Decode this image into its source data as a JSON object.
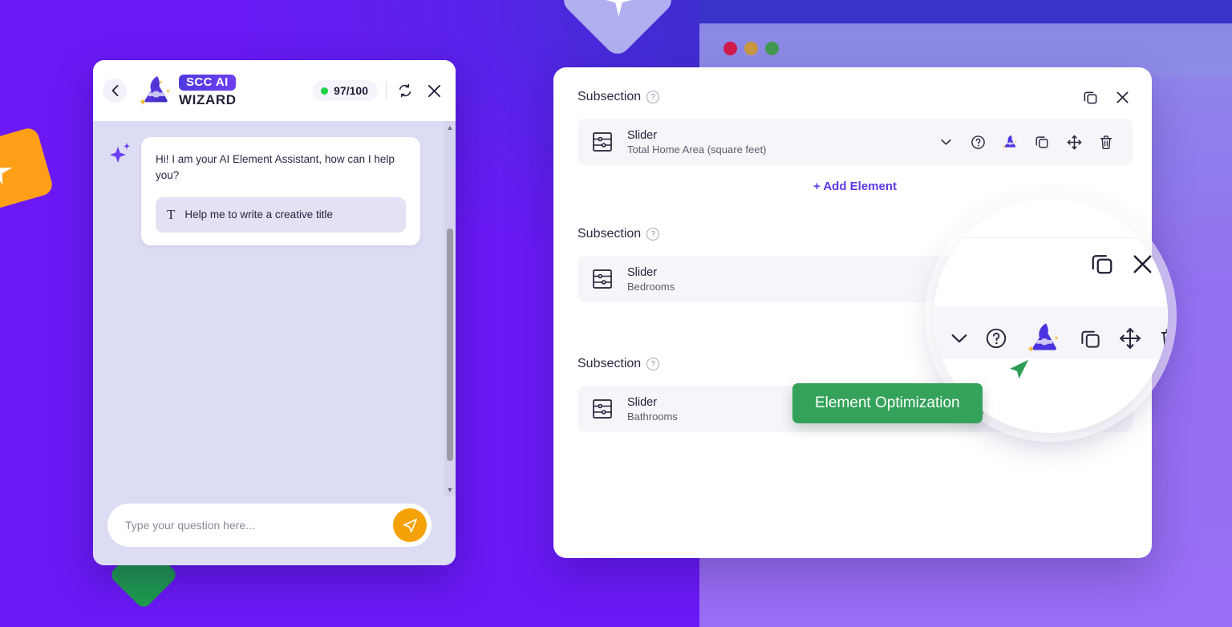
{
  "background": {
    "gradient_from": "#3a32c9",
    "gradient_to": "#6a19f5",
    "right_panel_from": "#8f8ce9",
    "right_panel_to": "#9a6df4",
    "shapes": [
      {
        "name": "orange-square",
        "color": "#ff9f17"
      },
      {
        "name": "lilac-diamond",
        "color": "#b0b0f0"
      },
      {
        "name": "green-diamond",
        "color": "#1f9d4f"
      }
    ]
  },
  "window_controls": {
    "close_color": "#cf1a4a",
    "minimize_color": "#c89640",
    "maximize_color": "#41974f"
  },
  "chat": {
    "back_icon": "chevron-left-icon",
    "brand": {
      "pill": "SCC AI",
      "word": "WIZARD",
      "logo": "wizard-hat-icon"
    },
    "credits": {
      "value": "97/100",
      "status_color": "#1fd14b"
    },
    "refresh_icon": "refresh-icon",
    "close_icon": "close-icon",
    "message": {
      "avatar_icon": "sparkle-icon",
      "text": "Hi! I am your AI Element Assistant, how can I help you?",
      "suggestion": {
        "icon": "text-format-icon",
        "label": "Help me to write a creative title"
      }
    },
    "input": {
      "placeholder": "Type your question here...",
      "value": "",
      "send_icon": "send-icon",
      "send_color": "#f5a208"
    },
    "scrollbar": {
      "up_icon": "caret-up-icon",
      "down_icon": "caret-down-icon"
    }
  },
  "builder": {
    "help_glyph": "?",
    "add_element_label": "+ Add Element",
    "subsections": [
      {
        "title": "Subsection",
        "actions": [
          "duplicate-icon",
          "close-icon"
        ],
        "element": {
          "icon": "slider-element-icon",
          "type": "Slider",
          "name": "Total Home Area (square feet)",
          "actions": [
            "chevron-down-icon",
            "help-icon",
            "wizard-icon",
            "duplicate-icon",
            "move-icon",
            "delete-icon"
          ]
        },
        "show_add_element": true
      },
      {
        "title": "Subsection",
        "actions": [
          "duplicate-icon",
          "close-icon"
        ],
        "element": {
          "icon": "slider-element-icon",
          "type": "Slider",
          "name": "Bedrooms",
          "actions": [
            "chevron-down-icon",
            "help-icon",
            "wizard-icon",
            "duplicate-icon",
            "move-icon",
            "delete-icon"
          ]
        },
        "show_add_element": false
      },
      {
        "title": "Subsection",
        "actions": [
          "duplicate-icon",
          "close-icon"
        ],
        "element": {
          "icon": "slider-element-icon",
          "type": "Slider",
          "name": "Bathrooms",
          "actions": [
            "chevron-down-icon",
            "help-icon",
            "wizard-icon",
            "duplicate-icon",
            "move-icon",
            "delete-icon"
          ]
        },
        "show_add_element": false
      }
    ]
  },
  "callout": {
    "tooltip_label": "Element Optimization",
    "tooltip_color": "#35a25b",
    "cursor_color": "#2e9e55",
    "magnified_icon": "wizard-icon"
  }
}
